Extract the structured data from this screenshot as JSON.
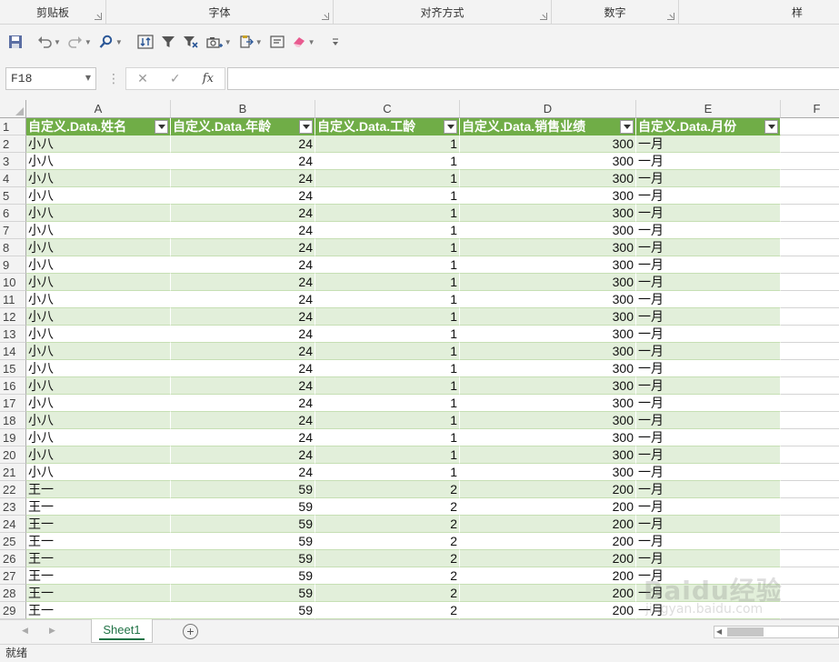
{
  "ribbon": {
    "groups": [
      {
        "label": "剪贴板"
      },
      {
        "label": "字体"
      },
      {
        "label": "对齐方式"
      },
      {
        "label": "数字"
      },
      {
        "label": "样"
      }
    ]
  },
  "qat": {
    "icons": [
      "save-icon",
      "undo-icon",
      "redo-icon",
      "find-icon",
      "sort-icon",
      "filter-icon",
      "clear-filter-icon",
      "camera-icon",
      "paste-format-icon",
      "textbox-icon",
      "eraser-icon",
      "customize-icon"
    ]
  },
  "formula_bar": {
    "name_box": "F18",
    "cancel_glyph": "✕",
    "enter_glyph": "✓",
    "fx_label": "fx",
    "formula": ""
  },
  "columns": [
    "A",
    "B",
    "C",
    "D",
    "E",
    "F"
  ],
  "table": {
    "headers": [
      "自定义.Data.姓名",
      "自定义.Data.年龄",
      "自定义.Data.工龄",
      "自定义.Data.销售业绩",
      "自定义.Data.月份"
    ],
    "rows": [
      [
        "2",
        "小八",
        "24",
        "1",
        "300",
        "一月"
      ],
      [
        "3",
        "小八",
        "24",
        "1",
        "300",
        "一月"
      ],
      [
        "4",
        "小八",
        "24",
        "1",
        "300",
        "一月"
      ],
      [
        "5",
        "小八",
        "24",
        "1",
        "300",
        "一月"
      ],
      [
        "6",
        "小八",
        "24",
        "1",
        "300",
        "一月"
      ],
      [
        "7",
        "小八",
        "24",
        "1",
        "300",
        "一月"
      ],
      [
        "8",
        "小八",
        "24",
        "1",
        "300",
        "一月"
      ],
      [
        "9",
        "小八",
        "24",
        "1",
        "300",
        "一月"
      ],
      [
        "10",
        "小八",
        "24",
        "1",
        "300",
        "一月"
      ],
      [
        "11",
        "小八",
        "24",
        "1",
        "300",
        "一月"
      ],
      [
        "12",
        "小八",
        "24",
        "1",
        "300",
        "一月"
      ],
      [
        "13",
        "小八",
        "24",
        "1",
        "300",
        "一月"
      ],
      [
        "14",
        "小八",
        "24",
        "1",
        "300",
        "一月"
      ],
      [
        "15",
        "小八",
        "24",
        "1",
        "300",
        "一月"
      ],
      [
        "16",
        "小八",
        "24",
        "1",
        "300",
        "一月"
      ],
      [
        "17",
        "小八",
        "24",
        "1",
        "300",
        "一月"
      ],
      [
        "18",
        "小八",
        "24",
        "1",
        "300",
        "一月"
      ],
      [
        "19",
        "小八",
        "24",
        "1",
        "300",
        "一月"
      ],
      [
        "20",
        "小八",
        "24",
        "1",
        "300",
        "一月"
      ],
      [
        "21",
        "小八",
        "24",
        "1",
        "300",
        "一月"
      ],
      [
        "22",
        "王一",
        "59",
        "2",
        "200",
        "一月"
      ],
      [
        "23",
        "王一",
        "59",
        "2",
        "200",
        "一月"
      ],
      [
        "24",
        "王一",
        "59",
        "2",
        "200",
        "一月"
      ],
      [
        "25",
        "王一",
        "59",
        "2",
        "200",
        "一月"
      ],
      [
        "26",
        "王一",
        "59",
        "2",
        "200",
        "一月"
      ],
      [
        "27",
        "王一",
        "59",
        "2",
        "200",
        "一月"
      ],
      [
        "28",
        "王一",
        "59",
        "2",
        "200",
        "一月"
      ],
      [
        "29",
        "王一",
        "59",
        "2",
        "200",
        "一月"
      ]
    ],
    "header_row_number": "1"
  },
  "sheets": {
    "tabs": [
      "Sheet1"
    ],
    "add_glyph": "+"
  },
  "status": {
    "text": "就绪"
  },
  "watermark": {
    "logo_text": "Baidu经验",
    "url_text": "jingyan.baidu.com"
  },
  "colors": {
    "header_green": "#70ad47",
    "band_green": "#e2efda",
    "excel_green": "#217346"
  }
}
